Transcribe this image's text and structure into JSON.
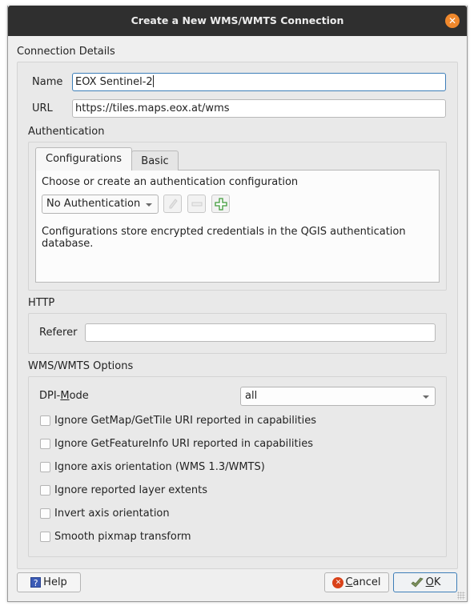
{
  "window": {
    "title": "Create a New WMS/WMTS Connection",
    "close_icon": "close-icon"
  },
  "connection_details": {
    "label": "Connection Details",
    "name_label": "Name",
    "name_value": "EOX Sentinel-2",
    "url_label": "URL",
    "url_value": "https://tiles.maps.eox.at/wms"
  },
  "authentication": {
    "label": "Authentication",
    "tabs": [
      {
        "label": "Configurations",
        "active": true
      },
      {
        "label": "Basic",
        "active": false
      }
    ],
    "prompt": "Choose or create an authentication configuration",
    "config_select": "No Authentication",
    "tool_buttons": [
      {
        "name": "edit",
        "icon": "pencil-icon",
        "enabled": false
      },
      {
        "name": "remove",
        "icon": "minus-icon",
        "enabled": false
      },
      {
        "name": "add",
        "icon": "plus-icon",
        "enabled": true
      }
    ],
    "info": "Configurations store encrypted credentials in the QGIS authentication database."
  },
  "http": {
    "label": "HTTP",
    "referer_label": "Referer",
    "referer_value": ""
  },
  "options": {
    "label": "WMS/WMTS Options",
    "dpi_label_pre": "DPI-",
    "dpi_label_mnemonic": "M",
    "dpi_label_post": "ode",
    "dpi_value": "all",
    "checkboxes": [
      {
        "label": "Ignore GetMap/GetTile URI reported in capabilities",
        "checked": false
      },
      {
        "label": "Ignore GetFeatureInfo URI reported in capabilities",
        "checked": false
      },
      {
        "label": "Ignore axis orientation (WMS 1.3/WMTS)",
        "checked": false
      },
      {
        "label": "Ignore reported layer extents",
        "checked": false
      },
      {
        "label": "Invert axis orientation",
        "checked": false
      },
      {
        "label": "Smooth pixmap transform",
        "checked": false
      }
    ]
  },
  "buttons": {
    "help": "Help",
    "cancel_mnemonic": "C",
    "cancel_rest": "ancel",
    "ok_mnemonic": "O",
    "ok_rest": "K"
  },
  "colors": {
    "titlebar": "#2f2f2f",
    "close_button": "#f0882c",
    "focus_border": "#3d7eb8",
    "cancel_icon": "#d9421a",
    "help_icon": "#3b5bb5",
    "add_icon": "#3f9a3a"
  }
}
